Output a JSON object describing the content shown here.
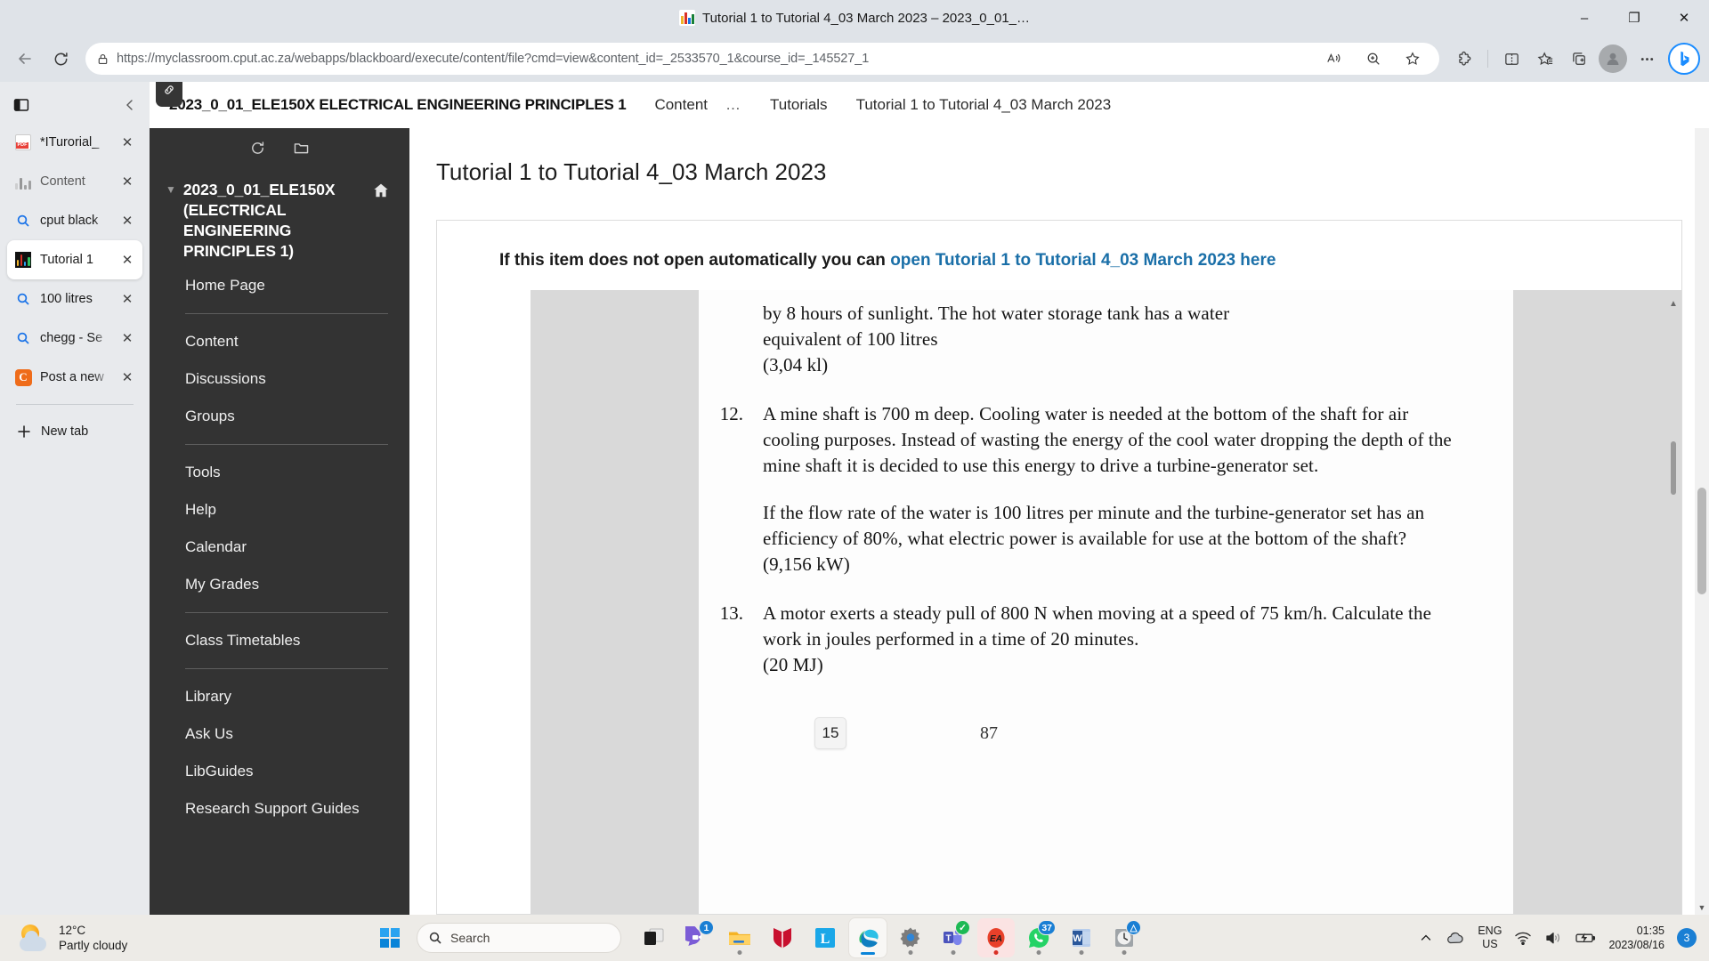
{
  "window": {
    "title": "Tutorial 1 to Tutorial 4_03 March 2023 – 2023_0_01_…",
    "minimize": "–",
    "maximize": "❐",
    "close": "✕"
  },
  "toolbar": {
    "back_icon": "back-arrow-icon",
    "refresh_icon": "refresh-icon",
    "url_prefix": "https://",
    "url_domain": "myclassroom.cput.ac.za",
    "url_path": "/webapps/blackboard/execute/content/file?cmd=view&content_id=_2533570_1&course_id=_145527_1",
    "url_full": "https://myclassroom.cput.ac.za/webapps/blackboard/execute/content/file?cmd=view&content_id=_2533570_1&course_id=_145527_1",
    "read_aloud_label": "Read aloud",
    "zoom_label": "Zoom",
    "favorite_label": "Add to favourites",
    "extensions_label": "Extensions",
    "split_screen_label": "Split screen",
    "collections_label": "Collections",
    "add_tab_group_label": "Add to tab group",
    "profile_label": "Profile",
    "settings_label": "Settings and more",
    "copilot_label": "Copilot"
  },
  "vertical_tabs": {
    "sidebar_toggle": "sidebar-toggle",
    "collapse_label": "‹",
    "items": [
      {
        "label": "*ITurorial_",
        "icon": "pdf-file-icon",
        "active": false
      },
      {
        "label": "Content",
        "icon": "blackboard-icon-grey",
        "active": false
      },
      {
        "label": "cput black",
        "icon": "search-icon",
        "active": false
      },
      {
        "label": "Tutorial 1",
        "icon": "blackboard-icon",
        "active": true
      },
      {
        "label": "100 litres",
        "icon": "search-icon",
        "active": false
      },
      {
        "label": "chegg - Se",
        "icon": "search-icon",
        "active": false
      },
      {
        "label": "Post a new",
        "icon": "chegg-icon",
        "active": false
      }
    ],
    "new_tab_label": "New tab",
    "new_tab_icon": "plus-icon"
  },
  "breadcrumb": {
    "course": "2023_0_01_ELE150X ELECTRICAL ENGINEERING PRINCIPLES 1",
    "items": [
      "Content",
      "…",
      "Tutorials",
      "Tutorial 1 to Tutorial 4_03 March 2023"
    ]
  },
  "course_menu": {
    "refresh_icon": "refresh-course-menu-icon",
    "folder_icon": "folder-view-icon",
    "caret_icon": "chevron-down-icon",
    "home_icon": "home-icon",
    "title": "2023_0_01_ELE150X (ELECTRICAL ENGINEERING PRINCIPLES 1)",
    "groups": [
      {
        "items": [
          "Home Page"
        ]
      },
      {
        "items": [
          "Content",
          "Discussions",
          "Groups"
        ]
      },
      {
        "items": [
          "Tools",
          "Help",
          "Calendar",
          "My Grades"
        ]
      },
      {
        "items": [
          "Class Timetables"
        ]
      },
      {
        "items": [
          "Library",
          "Ask Us",
          "LibGuides",
          "Research Support Guides"
        ]
      }
    ]
  },
  "content": {
    "page_title": "Tutorial 1 to Tutorial 4_03 March 2023",
    "note_prefix": "If this item does not open automatically you can ",
    "note_link": "open Tutorial 1 to Tutorial 4_03 March 2023 here",
    "link_color": "#1a6fa8"
  },
  "pdf": {
    "question_11_tail": [
      "by 8 hours of sunlight. The hot water storage tank has a water",
      "equivalent of 100 litres"
    ],
    "question_11_answer": "(3,04 kl)",
    "questions": [
      {
        "number": "12.",
        "paragraphs": [
          "A mine shaft is 700 m deep. Cooling water is needed at the bottom of the shaft for air cooling purposes. Instead of wasting the energy of the cool water dropping the depth of the mine shaft it is decided to use this energy to drive a turbine-generator set.",
          "If the flow rate of the water is 100 litres per minute and the turbine-generator set has an efficiency of 80%, what electric power is available for use at the bottom of the shaft?"
        ],
        "answer": "(9,156 kW)"
      },
      {
        "number": "13.",
        "paragraphs": [
          "A motor exerts a steady pull of 800 N when moving at a speed of 75 km/h. Calculate the work in joules performed in a time of 20 minutes."
        ],
        "answer": "(20 MJ)"
      }
    ],
    "page_badge": "15",
    "page_number": "87",
    "scroll_up_icon": "scroll-up-arrow-icon",
    "scroll_down_icon": "scroll-down-arrow-icon"
  },
  "taskbar": {
    "weather_temp": "12°C",
    "weather_desc": "Partly cloudy",
    "weather_icon": "partly-cloudy-icon",
    "start_label": "Start",
    "search_placeholder": "Search",
    "apps": [
      {
        "name": "task-view",
        "badge": "",
        "running": false
      },
      {
        "name": "chat-teams",
        "badge": "1",
        "running": false
      },
      {
        "name": "file-explorer",
        "badge": "",
        "running": true
      },
      {
        "name": "mcafee",
        "badge": "",
        "running": false
      },
      {
        "name": "lastpass",
        "badge": "",
        "running": false
      },
      {
        "name": "microsoft-edge",
        "badge": "",
        "running": true,
        "active": true
      },
      {
        "name": "settings",
        "badge": "",
        "running": true
      },
      {
        "name": "microsoft-teams",
        "badge": "✓",
        "running": true
      },
      {
        "name": "ea-app",
        "badge": "",
        "running": true
      },
      {
        "name": "whatsapp",
        "badge": "37",
        "running": true
      },
      {
        "name": "microsoft-word",
        "badge": "",
        "running": true
      },
      {
        "name": "clock-alarms",
        "badge": "△",
        "running": true
      }
    ],
    "tray": {
      "chevron": "˄",
      "onedrive_icon": "onedrive-icon",
      "lang_line1": "ENG",
      "lang_line2": "US",
      "wifi_icon": "wifi-icon",
      "volume_icon": "volume-icon",
      "battery_icon": "battery-charging-icon",
      "time": "01:35",
      "date": "2023/08/16",
      "notification_count": "3"
    }
  }
}
